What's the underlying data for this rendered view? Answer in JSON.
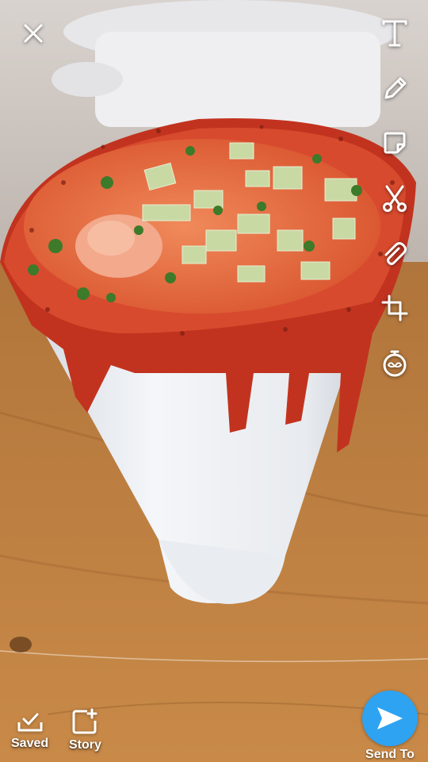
{
  "toolbar": {
    "close_icon": "close-icon",
    "items": [
      {
        "name": "text-tool",
        "icon": "text-icon",
        "glyph": "T"
      },
      {
        "name": "pencil-tool",
        "icon": "pencil-icon"
      },
      {
        "name": "sticker-tool",
        "icon": "sticker-icon"
      },
      {
        "name": "scissors-tool",
        "icon": "scissors-icon"
      },
      {
        "name": "attach-tool",
        "icon": "paperclip-icon"
      },
      {
        "name": "crop-tool",
        "icon": "crop-icon"
      },
      {
        "name": "timer-tool",
        "icon": "timer-icon"
      }
    ]
  },
  "bottom": {
    "saved_label": "Saved",
    "story_label": "Story",
    "send_label": "Send To"
  },
  "colors": {
    "accent": "#2ea3f2",
    "icon": "#ffffff"
  }
}
